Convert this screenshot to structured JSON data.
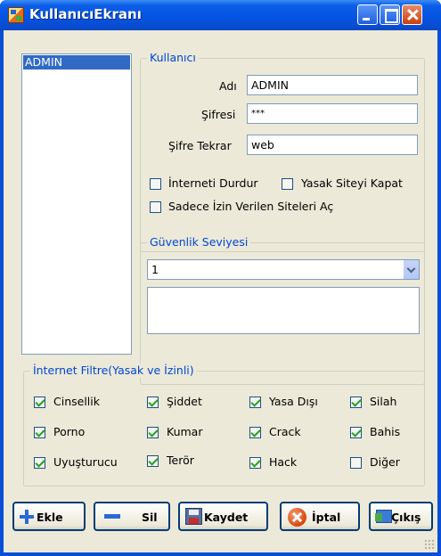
{
  "window": {
    "title": "KullanıcıEkranı"
  },
  "user_list": {
    "items": [
      "ADMIN"
    ]
  },
  "user_group": {
    "title": "Kullanıcı",
    "name_label": "Adı",
    "name_value": "ADMIN",
    "password_label": "Şifresi",
    "password_value": "***",
    "password_repeat_label": "Şifre Tekrar",
    "password_repeat_value": "web",
    "options": [
      {
        "label": "İnterneti Durdur",
        "checked": false
      },
      {
        "label": "Yasak Siteyi Kapat",
        "checked": false
      },
      {
        "label": "Sadece İzin Verilen Siteleri Aç",
        "checked": false
      }
    ]
  },
  "security_group": {
    "title": "Güvenlik Seviyesi",
    "level_value": "1",
    "level_description": ""
  },
  "filter_group": {
    "title": "İnternet Filtre(Yasak ve İzinli)",
    "items": [
      {
        "label": "Cinsellik",
        "checked": true
      },
      {
        "label": "Şiddet",
        "checked": true
      },
      {
        "label": "Yasa Dışı",
        "checked": true
      },
      {
        "label": "Silah",
        "checked": true
      },
      {
        "label": "Porno",
        "checked": true
      },
      {
        "label": "Kumar",
        "checked": true
      },
      {
        "label": "Crack",
        "checked": true
      },
      {
        "label": "Bahis",
        "checked": true
      },
      {
        "label": "Uyuşturucu",
        "checked": true
      },
      {
        "label": "Terör",
        "checked": true
      },
      {
        "label": "Hack",
        "checked": true
      },
      {
        "label": "Diğer",
        "checked": false
      }
    ]
  },
  "buttons": {
    "add": "Ekle",
    "delete": "Sil",
    "save": "Kaydet",
    "cancel": "İptal",
    "exit": "Çıkış"
  },
  "colors": {
    "titlebar": "#0554e3",
    "client_bg": "#ece9d8",
    "group_title": "#0046d5",
    "selection": "#316ac5",
    "check": "#21a121"
  }
}
